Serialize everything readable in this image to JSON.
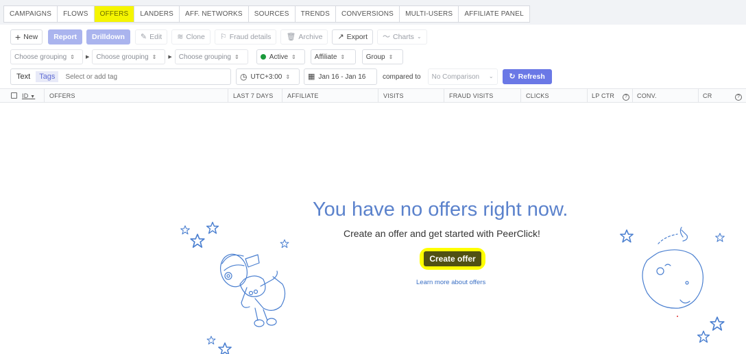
{
  "tabs": [
    {
      "label": "CAMPAIGNS",
      "active": false
    },
    {
      "label": "FLOWS",
      "active": false
    },
    {
      "label": "OFFERS",
      "active": true
    },
    {
      "label": "LANDERS",
      "active": false
    },
    {
      "label": "AFF. NETWORKS",
      "active": false
    },
    {
      "label": "SOURCES",
      "active": false
    },
    {
      "label": "TRENDS",
      "active": false
    },
    {
      "label": "CONVERSIONS",
      "active": false
    },
    {
      "label": "MULTI-USERS",
      "active": false
    },
    {
      "label": "AFFILIATE PANEL",
      "active": false
    }
  ],
  "toolbar": {
    "new": "New",
    "report": "Report",
    "drilldown": "Drilldown",
    "edit": "Edit",
    "clone": "Clone",
    "fraud_details": "Fraud details",
    "archive": "Archive",
    "export": "Export",
    "charts": "Charts"
  },
  "grouping": {
    "g1": "Choose grouping",
    "g2": "Choose grouping",
    "g3": "Choose grouping",
    "status": "Active",
    "affiliate": "Affiliate",
    "group": "Group"
  },
  "filters": {
    "tag_text": "Text",
    "tag_tags": "Tags",
    "tag_placeholder": "Select or add tag",
    "timezone": "UTC+3:00",
    "date_range": "Jan 16 - Jan 16",
    "compared_to": "compared to",
    "comparison": "No Comparison",
    "refresh": "Refresh"
  },
  "columns": {
    "id": "ID",
    "offers": "OFFERS",
    "last7": "LAST 7 DAYS",
    "affiliate": "AFFILIATE",
    "visits": "VISITS",
    "fraud_visits": "FRAUD VISITS",
    "clicks": "CLICKS",
    "lp_ctr": "LP CTR",
    "conv": "CONV.",
    "cr": "CR",
    "help": "?"
  },
  "empty_state": {
    "title": "You have no offers right now.",
    "subtitle": "Create an offer and get started with PeerClick!",
    "create_button": "Create offer",
    "learn_more": "Learn more about offers"
  },
  "colors": {
    "accent": "#6a78e6",
    "highlight": "#ffff00",
    "illustration": "#4a7fd0",
    "active_dot": "#1b9a3b"
  }
}
